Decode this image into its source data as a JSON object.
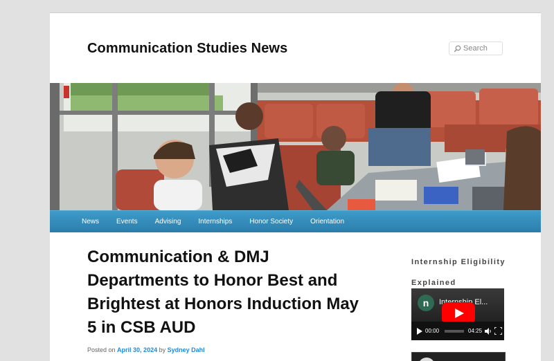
{
  "site": {
    "title": "Communication Studies News"
  },
  "search": {
    "placeholder": "Search"
  },
  "nav": {
    "items": [
      "News",
      "Events",
      "Advising",
      "Internships",
      "Honor Society",
      "Orientation"
    ]
  },
  "post": {
    "title": "Communication & DMJ Departments to Honor Best and Brightest at Honors Induction May 5 in CSB AUD",
    "posted_on_label": "Posted on",
    "date": "April 30, 2024",
    "by_label": "by",
    "author": "Sydney Dahl"
  },
  "sidebar": {
    "widget_title": "Internship Eligibility Explained",
    "video": {
      "channel_initial": "n",
      "title": "Internship El...",
      "current_time": "00:00",
      "duration": "04:25"
    }
  },
  "colors": {
    "nav_bg": "#2f86b6",
    "link": "#1b8be0",
    "youtube_red": "#ff0000"
  },
  "icons": {
    "search": "search-icon",
    "play": "play-icon",
    "volume": "volume-icon",
    "fullscreen": "fullscreen-icon"
  }
}
